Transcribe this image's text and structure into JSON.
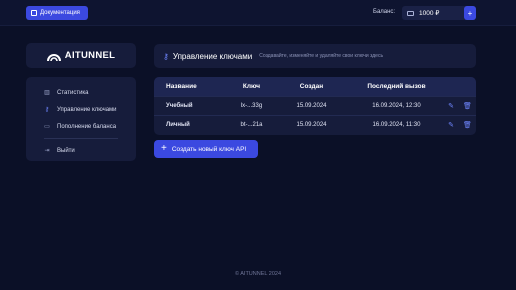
{
  "topbar": {
    "docs_label": "Документация",
    "balance_label": "Баланс:",
    "balance_value": "1000 ₽",
    "add_label": "+"
  },
  "logo": {
    "text_ai": "AI",
    "text_rest": "TUNNEL"
  },
  "sidebar": {
    "items": [
      {
        "label": "Статистика",
        "icon": "chart-icon"
      },
      {
        "label": "Управление ключами",
        "icon": "key-icon"
      },
      {
        "label": "Пополнение баланса",
        "icon": "card-icon"
      },
      {
        "label": "Выйти",
        "icon": "logout-icon"
      }
    ]
  },
  "header": {
    "title": "Управление ключами",
    "subtitle": "Создавайте, изменяйте и удаляйте свои ключи здесь"
  },
  "table": {
    "columns": [
      "Название",
      "Ключ",
      "Создан",
      "Последний вызов"
    ],
    "rows": [
      {
        "name": "Учебный",
        "key": "lx-...33g",
        "created": "15.09.2024",
        "last": "16.09.2024, 12:30"
      },
      {
        "name": "Личный",
        "key": "bt-...21a",
        "created": "15.09.2024",
        "last": "16.09.2024, 11:30"
      }
    ]
  },
  "create_button": {
    "label": "Создать новый ключ API"
  },
  "footer": {
    "text": "© AITUNNEL 2024"
  },
  "colors": {
    "accent": "#3b49e0",
    "background": "#0b1027",
    "card": "#161c3b"
  }
}
